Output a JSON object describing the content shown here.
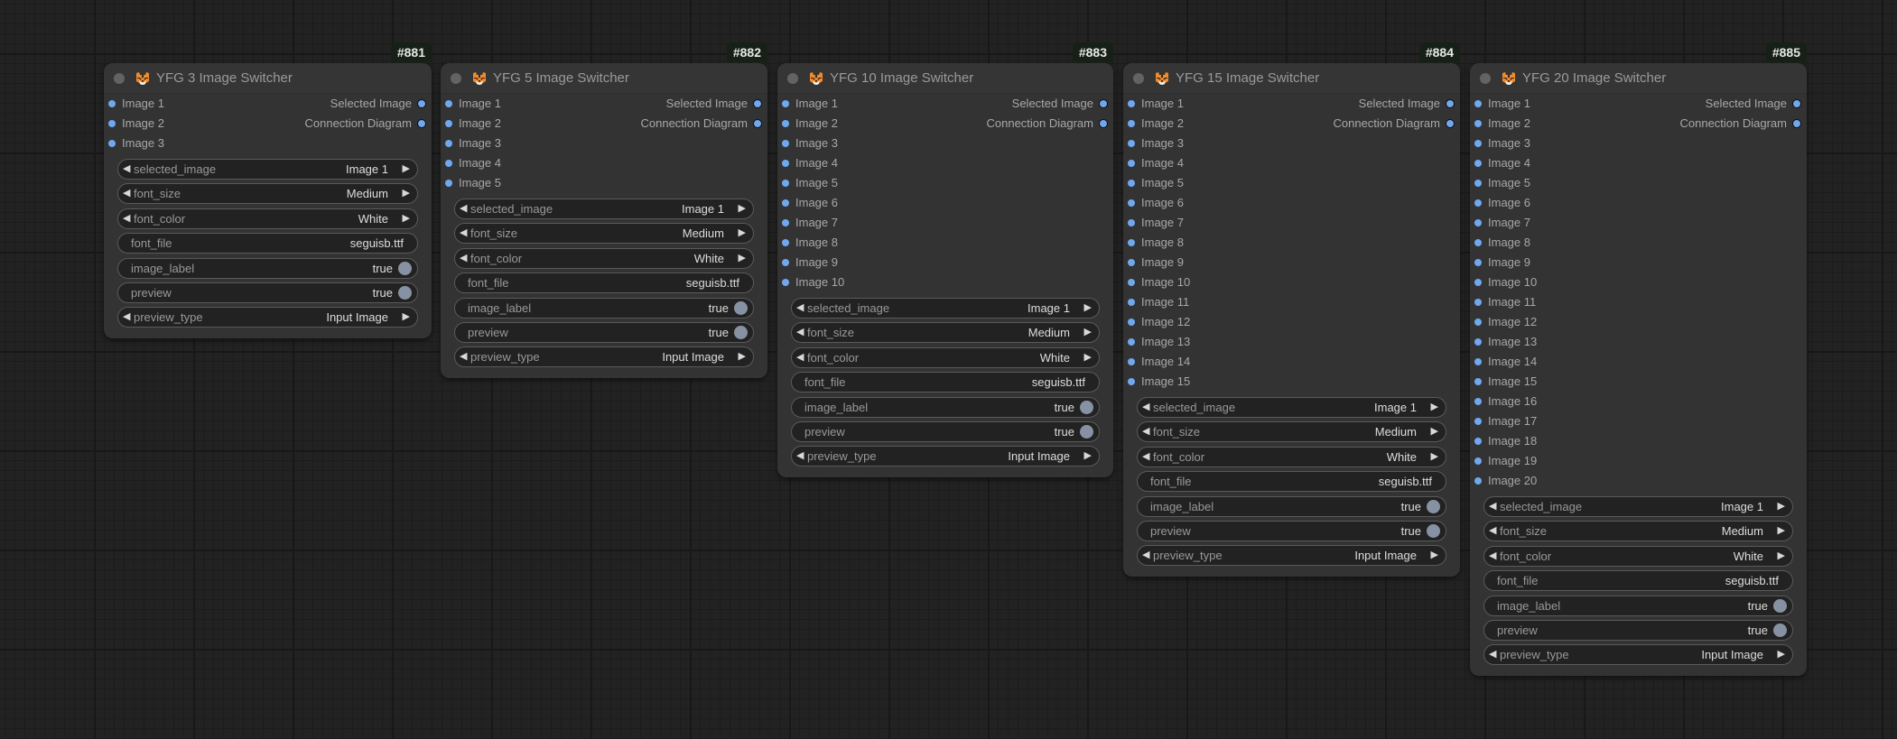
{
  "canvas": {
    "colors": {
      "background": "#222222",
      "node_body": "#333333",
      "node_header": "#353535",
      "slot_dot": "#70a8ef",
      "badge_bg": "#162016",
      "toggle_knob": "#8692a3"
    }
  },
  "nodes": [
    {
      "id": "#881",
      "icon": "tiger-icon",
      "title": "YFG 3 Image Switcher",
      "inputs": [
        "Image 1",
        "Image 2",
        "Image 3"
      ],
      "outputs": [
        "Selected Image",
        "Connection Diagram"
      ],
      "widgets": [
        {
          "type": "combo",
          "label": "selected_image",
          "value": "Image 1"
        },
        {
          "type": "combo",
          "label": "font_size",
          "value": "Medium"
        },
        {
          "type": "combo",
          "label": "font_color",
          "value": "White"
        },
        {
          "type": "text",
          "label": "font_file",
          "value": "seguisb.ttf"
        },
        {
          "type": "toggle",
          "label": "image_label",
          "value": "true"
        },
        {
          "type": "toggle",
          "label": "preview",
          "value": "true"
        },
        {
          "type": "combo",
          "label": "preview_type",
          "value": "Input Image"
        }
      ]
    },
    {
      "id": "#882",
      "icon": "tiger-icon",
      "title": "YFG 5 Image Switcher",
      "inputs": [
        "Image 1",
        "Image 2",
        "Image 3",
        "Image 4",
        "Image 5"
      ],
      "outputs": [
        "Selected Image",
        "Connection Diagram"
      ],
      "widgets": [
        {
          "type": "combo",
          "label": "selected_image",
          "value": "Image 1"
        },
        {
          "type": "combo",
          "label": "font_size",
          "value": "Medium"
        },
        {
          "type": "combo",
          "label": "font_color",
          "value": "White"
        },
        {
          "type": "text",
          "label": "font_file",
          "value": "seguisb.ttf"
        },
        {
          "type": "toggle",
          "label": "image_label",
          "value": "true"
        },
        {
          "type": "toggle",
          "label": "preview",
          "value": "true"
        },
        {
          "type": "combo",
          "label": "preview_type",
          "value": "Input Image"
        }
      ]
    },
    {
      "id": "#883",
      "icon": "tiger-icon",
      "title": "YFG 10 Image Switcher",
      "inputs": [
        "Image 1",
        "Image 2",
        "Image 3",
        "Image 4",
        "Image 5",
        "Image 6",
        "Image 7",
        "Image 8",
        "Image 9",
        "Image 10"
      ],
      "outputs": [
        "Selected Image",
        "Connection Diagram"
      ],
      "widgets": [
        {
          "type": "combo",
          "label": "selected_image",
          "value": "Image 1"
        },
        {
          "type": "combo",
          "label": "font_size",
          "value": "Medium"
        },
        {
          "type": "combo",
          "label": "font_color",
          "value": "White"
        },
        {
          "type": "text",
          "label": "font_file",
          "value": "seguisb.ttf"
        },
        {
          "type": "toggle",
          "label": "image_label",
          "value": "true"
        },
        {
          "type": "toggle",
          "label": "preview",
          "value": "true"
        },
        {
          "type": "combo",
          "label": "preview_type",
          "value": "Input Image"
        }
      ]
    },
    {
      "id": "#884",
      "icon": "tiger-icon",
      "title": "YFG 15 Image Switcher",
      "inputs": [
        "Image 1",
        "Image 2",
        "Image 3",
        "Image 4",
        "Image 5",
        "Image 6",
        "Image 7",
        "Image 8",
        "Image 9",
        "Image 10",
        "Image 11",
        "Image 12",
        "Image 13",
        "Image 14",
        "Image 15"
      ],
      "outputs": [
        "Selected Image",
        "Connection Diagram"
      ],
      "widgets": [
        {
          "type": "combo",
          "label": "selected_image",
          "value": "Image 1"
        },
        {
          "type": "combo",
          "label": "font_size",
          "value": "Medium"
        },
        {
          "type": "combo",
          "label": "font_color",
          "value": "White"
        },
        {
          "type": "text",
          "label": "font_file",
          "value": "seguisb.ttf"
        },
        {
          "type": "toggle",
          "label": "image_label",
          "value": "true"
        },
        {
          "type": "toggle",
          "label": "preview",
          "value": "true"
        },
        {
          "type": "combo",
          "label": "preview_type",
          "value": "Input Image"
        }
      ]
    },
    {
      "id": "#885",
      "icon": "tiger-icon",
      "title": "YFG 20 Image Switcher",
      "inputs": [
        "Image 1",
        "Image 2",
        "Image 3",
        "Image 4",
        "Image 5",
        "Image 6",
        "Image 7",
        "Image 8",
        "Image 9",
        "Image 10",
        "Image 11",
        "Image 12",
        "Image 13",
        "Image 14",
        "Image 15",
        "Image 16",
        "Image 17",
        "Image 18",
        "Image 19",
        "Image 20"
      ],
      "outputs": [
        "Selected Image",
        "Connection Diagram"
      ],
      "widgets": [
        {
          "type": "combo",
          "label": "selected_image",
          "value": "Image 1"
        },
        {
          "type": "combo",
          "label": "font_size",
          "value": "Medium"
        },
        {
          "type": "combo",
          "label": "font_color",
          "value": "White"
        },
        {
          "type": "text",
          "label": "font_file",
          "value": "seguisb.ttf"
        },
        {
          "type": "toggle",
          "label": "image_label",
          "value": "true"
        },
        {
          "type": "toggle",
          "label": "preview",
          "value": "true"
        },
        {
          "type": "combo",
          "label": "preview_type",
          "value": "Input Image"
        }
      ]
    }
  ]
}
